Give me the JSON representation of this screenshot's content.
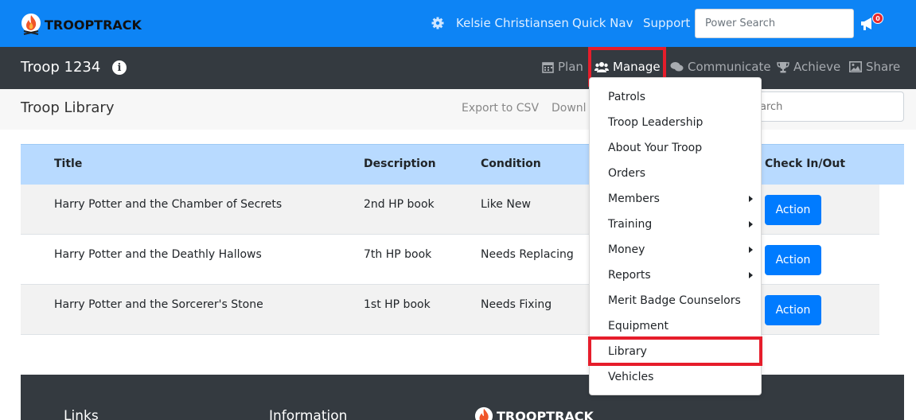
{
  "brand": {
    "name": "TROOPTRACK"
  },
  "top_nav": {
    "settings_icon": "gear-icon",
    "user": "Kelsie Christiansen",
    "quick_nav": "Quick Nav",
    "support": "Support",
    "search_placeholder": "Power Search",
    "notifications_icon": "megaphone-icon",
    "notifications_count": "0"
  },
  "troop_bar": {
    "title": "Troop 1234",
    "info_icon": "info-icon",
    "nav": [
      {
        "label": "Plan",
        "icon": "calendar-icon"
      },
      {
        "label": "Manage",
        "icon": "users-icon",
        "active": true
      },
      {
        "label": "Communicate",
        "icon": "comments-icon"
      },
      {
        "label": "Achieve",
        "icon": "trophy-icon"
      },
      {
        "label": "Share",
        "icon": "image-icon"
      }
    ]
  },
  "subheader": {
    "title": "Troop Library",
    "export_csv": "Export to CSV",
    "download": "Downl",
    "search_placeholder": "earch"
  },
  "table": {
    "headers": [
      "Title",
      "Description",
      "Condition",
      "Check In/Out"
    ],
    "rows": [
      {
        "title": "Harry Potter and the Chamber of Secrets",
        "description": "2nd HP book",
        "condition": "Like New",
        "action": "Action"
      },
      {
        "title": "Harry Potter and the Deathly Hallows",
        "description": "7th HP book",
        "condition": "Needs Replacing",
        "action": "Action"
      },
      {
        "title": "Harry Potter and the Sorcerer's Stone",
        "description": "1st HP book",
        "condition": "Needs Fixing",
        "action": "Action"
      }
    ]
  },
  "manage_menu": {
    "items": [
      {
        "label": "Patrols",
        "submenu": false
      },
      {
        "label": "Troop Leadership",
        "submenu": false
      },
      {
        "label": "About Your Troop",
        "submenu": false
      },
      {
        "label": "Orders",
        "submenu": false
      },
      {
        "label": "Members",
        "submenu": true
      },
      {
        "label": "Training",
        "submenu": true
      },
      {
        "label": "Money",
        "submenu": true
      },
      {
        "label": "Reports",
        "submenu": true
      },
      {
        "label": "Merit Badge Counselors",
        "submenu": false
      },
      {
        "label": "Equipment",
        "submenu": false
      },
      {
        "label": "Library",
        "submenu": false,
        "highlighted": true
      },
      {
        "label": "Vehicles",
        "submenu": false
      }
    ]
  },
  "footer": {
    "links_heading": "Links",
    "information_heading": "Information",
    "logo_text": "TROOPTRACK"
  },
  "colors": {
    "topbar": "#0d84f5",
    "darkbar": "#343a40",
    "table_header": "#b8daff",
    "button": "#007bff",
    "highlight": "#e61d2b"
  }
}
